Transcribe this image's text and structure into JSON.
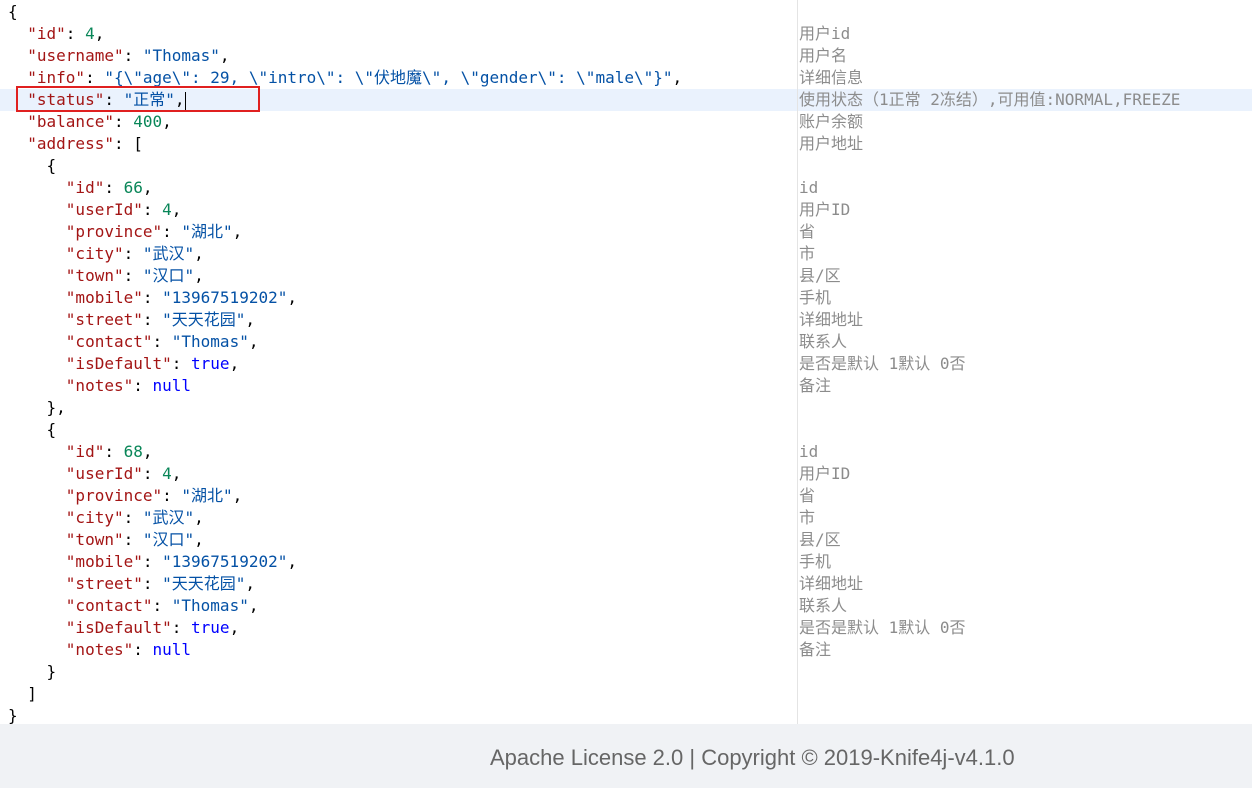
{
  "editor": {
    "highlighted_line": 5,
    "lines": [
      {
        "tokens": [
          {
            "t": "p",
            "v": "{"
          }
        ],
        "comment": ""
      },
      {
        "tokens": [
          {
            "t": "p",
            "v": "  "
          },
          {
            "t": "key",
            "v": "\"id\""
          },
          {
            "t": "p",
            "v": ": "
          },
          {
            "t": "num",
            "v": "4"
          },
          {
            "t": "p",
            "v": ","
          }
        ],
        "comment": "用户id"
      },
      {
        "tokens": [
          {
            "t": "p",
            "v": "  "
          },
          {
            "t": "key",
            "v": "\"username\""
          },
          {
            "t": "p",
            "v": ": "
          },
          {
            "t": "str",
            "v": "\"Thomas\""
          },
          {
            "t": "p",
            "v": ","
          }
        ],
        "comment": "用户名"
      },
      {
        "tokens": [
          {
            "t": "p",
            "v": "  "
          },
          {
            "t": "key",
            "v": "\"info\""
          },
          {
            "t": "p",
            "v": ": "
          },
          {
            "t": "str",
            "v": "\"{\\\"age\\\": 29, \\\"intro\\\": \\\"伏地魔\\\", \\\"gender\\\": \\\"male\\\"}\""
          },
          {
            "t": "p",
            "v": ","
          }
        ],
        "comment": "详细信息"
      },
      {
        "tokens": [
          {
            "t": "p",
            "v": "  "
          },
          {
            "t": "key",
            "v": "\"status\""
          },
          {
            "t": "p",
            "v": ": "
          },
          {
            "t": "str",
            "v": "\"正常\""
          },
          {
            "t": "p",
            "v": ","
          }
        ],
        "comment": "使用状态（1正常 2冻结）,可用值:NORMAL,FREEZE",
        "cursor": true
      },
      {
        "tokens": [
          {
            "t": "p",
            "v": "  "
          },
          {
            "t": "key",
            "v": "\"balance\""
          },
          {
            "t": "p",
            "v": ": "
          },
          {
            "t": "num",
            "v": "400"
          },
          {
            "t": "p",
            "v": ","
          }
        ],
        "comment": "账户余额"
      },
      {
        "tokens": [
          {
            "t": "p",
            "v": "  "
          },
          {
            "t": "key",
            "v": "\"address\""
          },
          {
            "t": "p",
            "v": ": ["
          }
        ],
        "comment": "用户地址"
      },
      {
        "tokens": [
          {
            "t": "p",
            "v": "    {"
          }
        ],
        "comment": ""
      },
      {
        "tokens": [
          {
            "t": "p",
            "v": "      "
          },
          {
            "t": "key",
            "v": "\"id\""
          },
          {
            "t": "p",
            "v": ": "
          },
          {
            "t": "num",
            "v": "66"
          },
          {
            "t": "p",
            "v": ","
          }
        ],
        "comment": "id"
      },
      {
        "tokens": [
          {
            "t": "p",
            "v": "      "
          },
          {
            "t": "key",
            "v": "\"userId\""
          },
          {
            "t": "p",
            "v": ": "
          },
          {
            "t": "num",
            "v": "4"
          },
          {
            "t": "p",
            "v": ","
          }
        ],
        "comment": "用户ID"
      },
      {
        "tokens": [
          {
            "t": "p",
            "v": "      "
          },
          {
            "t": "key",
            "v": "\"province\""
          },
          {
            "t": "p",
            "v": ": "
          },
          {
            "t": "str",
            "v": "\"湖北\""
          },
          {
            "t": "p",
            "v": ","
          }
        ],
        "comment": "省"
      },
      {
        "tokens": [
          {
            "t": "p",
            "v": "      "
          },
          {
            "t": "key",
            "v": "\"city\""
          },
          {
            "t": "p",
            "v": ": "
          },
          {
            "t": "str",
            "v": "\"武汉\""
          },
          {
            "t": "p",
            "v": ","
          }
        ],
        "comment": "市"
      },
      {
        "tokens": [
          {
            "t": "p",
            "v": "      "
          },
          {
            "t": "key",
            "v": "\"town\""
          },
          {
            "t": "p",
            "v": ": "
          },
          {
            "t": "str",
            "v": "\"汉口\""
          },
          {
            "t": "p",
            "v": ","
          }
        ],
        "comment": "县/区"
      },
      {
        "tokens": [
          {
            "t": "p",
            "v": "      "
          },
          {
            "t": "key",
            "v": "\"mobile\""
          },
          {
            "t": "p",
            "v": ": "
          },
          {
            "t": "str",
            "v": "\"13967519202\""
          },
          {
            "t": "p",
            "v": ","
          }
        ],
        "comment": "手机"
      },
      {
        "tokens": [
          {
            "t": "p",
            "v": "      "
          },
          {
            "t": "key",
            "v": "\"street\""
          },
          {
            "t": "p",
            "v": ": "
          },
          {
            "t": "str",
            "v": "\"天天花园\""
          },
          {
            "t": "p",
            "v": ","
          }
        ],
        "comment": "详细地址"
      },
      {
        "tokens": [
          {
            "t": "p",
            "v": "      "
          },
          {
            "t": "key",
            "v": "\"contact\""
          },
          {
            "t": "p",
            "v": ": "
          },
          {
            "t": "str",
            "v": "\"Thomas\""
          },
          {
            "t": "p",
            "v": ","
          }
        ],
        "comment": "联系人"
      },
      {
        "tokens": [
          {
            "t": "p",
            "v": "      "
          },
          {
            "t": "key",
            "v": "\"isDefault\""
          },
          {
            "t": "p",
            "v": ": "
          },
          {
            "t": "kw",
            "v": "true"
          },
          {
            "t": "p",
            "v": ","
          }
        ],
        "comment": "是否是默认 1默认 0否"
      },
      {
        "tokens": [
          {
            "t": "p",
            "v": "      "
          },
          {
            "t": "key",
            "v": "\"notes\""
          },
          {
            "t": "p",
            "v": ": "
          },
          {
            "t": "kw",
            "v": "null"
          }
        ],
        "comment": "备注"
      },
      {
        "tokens": [
          {
            "t": "p",
            "v": "    },"
          }
        ],
        "comment": ""
      },
      {
        "tokens": [
          {
            "t": "p",
            "v": "    {"
          }
        ],
        "comment": ""
      },
      {
        "tokens": [
          {
            "t": "p",
            "v": "      "
          },
          {
            "t": "key",
            "v": "\"id\""
          },
          {
            "t": "p",
            "v": ": "
          },
          {
            "t": "num",
            "v": "68"
          },
          {
            "t": "p",
            "v": ","
          }
        ],
        "comment": "id"
      },
      {
        "tokens": [
          {
            "t": "p",
            "v": "      "
          },
          {
            "t": "key",
            "v": "\"userId\""
          },
          {
            "t": "p",
            "v": ": "
          },
          {
            "t": "num",
            "v": "4"
          },
          {
            "t": "p",
            "v": ","
          }
        ],
        "comment": "用户ID"
      },
      {
        "tokens": [
          {
            "t": "p",
            "v": "      "
          },
          {
            "t": "key",
            "v": "\"province\""
          },
          {
            "t": "p",
            "v": ": "
          },
          {
            "t": "str",
            "v": "\"湖北\""
          },
          {
            "t": "p",
            "v": ","
          }
        ],
        "comment": "省"
      },
      {
        "tokens": [
          {
            "t": "p",
            "v": "      "
          },
          {
            "t": "key",
            "v": "\"city\""
          },
          {
            "t": "p",
            "v": ": "
          },
          {
            "t": "str",
            "v": "\"武汉\""
          },
          {
            "t": "p",
            "v": ","
          }
        ],
        "comment": "市"
      },
      {
        "tokens": [
          {
            "t": "p",
            "v": "      "
          },
          {
            "t": "key",
            "v": "\"town\""
          },
          {
            "t": "p",
            "v": ": "
          },
          {
            "t": "str",
            "v": "\"汉口\""
          },
          {
            "t": "p",
            "v": ","
          }
        ],
        "comment": "县/区"
      },
      {
        "tokens": [
          {
            "t": "p",
            "v": "      "
          },
          {
            "t": "key",
            "v": "\"mobile\""
          },
          {
            "t": "p",
            "v": ": "
          },
          {
            "t": "str",
            "v": "\"13967519202\""
          },
          {
            "t": "p",
            "v": ","
          }
        ],
        "comment": "手机"
      },
      {
        "tokens": [
          {
            "t": "p",
            "v": "      "
          },
          {
            "t": "key",
            "v": "\"street\""
          },
          {
            "t": "p",
            "v": ": "
          },
          {
            "t": "str",
            "v": "\"天天花园\""
          },
          {
            "t": "p",
            "v": ","
          }
        ],
        "comment": "详细地址"
      },
      {
        "tokens": [
          {
            "t": "p",
            "v": "      "
          },
          {
            "t": "key",
            "v": "\"contact\""
          },
          {
            "t": "p",
            "v": ": "
          },
          {
            "t": "str",
            "v": "\"Thomas\""
          },
          {
            "t": "p",
            "v": ","
          }
        ],
        "comment": "联系人"
      },
      {
        "tokens": [
          {
            "t": "p",
            "v": "      "
          },
          {
            "t": "key",
            "v": "\"isDefault\""
          },
          {
            "t": "p",
            "v": ": "
          },
          {
            "t": "kw",
            "v": "true"
          },
          {
            "t": "p",
            "v": ","
          }
        ],
        "comment": "是否是默认 1默认 0否"
      },
      {
        "tokens": [
          {
            "t": "p",
            "v": "      "
          },
          {
            "t": "key",
            "v": "\"notes\""
          },
          {
            "t": "p",
            "v": ": "
          },
          {
            "t": "kw",
            "v": "null"
          }
        ],
        "comment": "备注"
      },
      {
        "tokens": [
          {
            "t": "p",
            "v": "    }"
          }
        ],
        "comment": ""
      },
      {
        "tokens": [
          {
            "t": "p",
            "v": "  ]"
          }
        ],
        "comment": ""
      },
      {
        "tokens": [
          {
            "t": "p",
            "v": "}"
          }
        ],
        "comment": ""
      }
    ]
  },
  "footer": {
    "text": "Apache License 2.0 | Copyright © 2019-Knife4j-v4.1.0"
  }
}
